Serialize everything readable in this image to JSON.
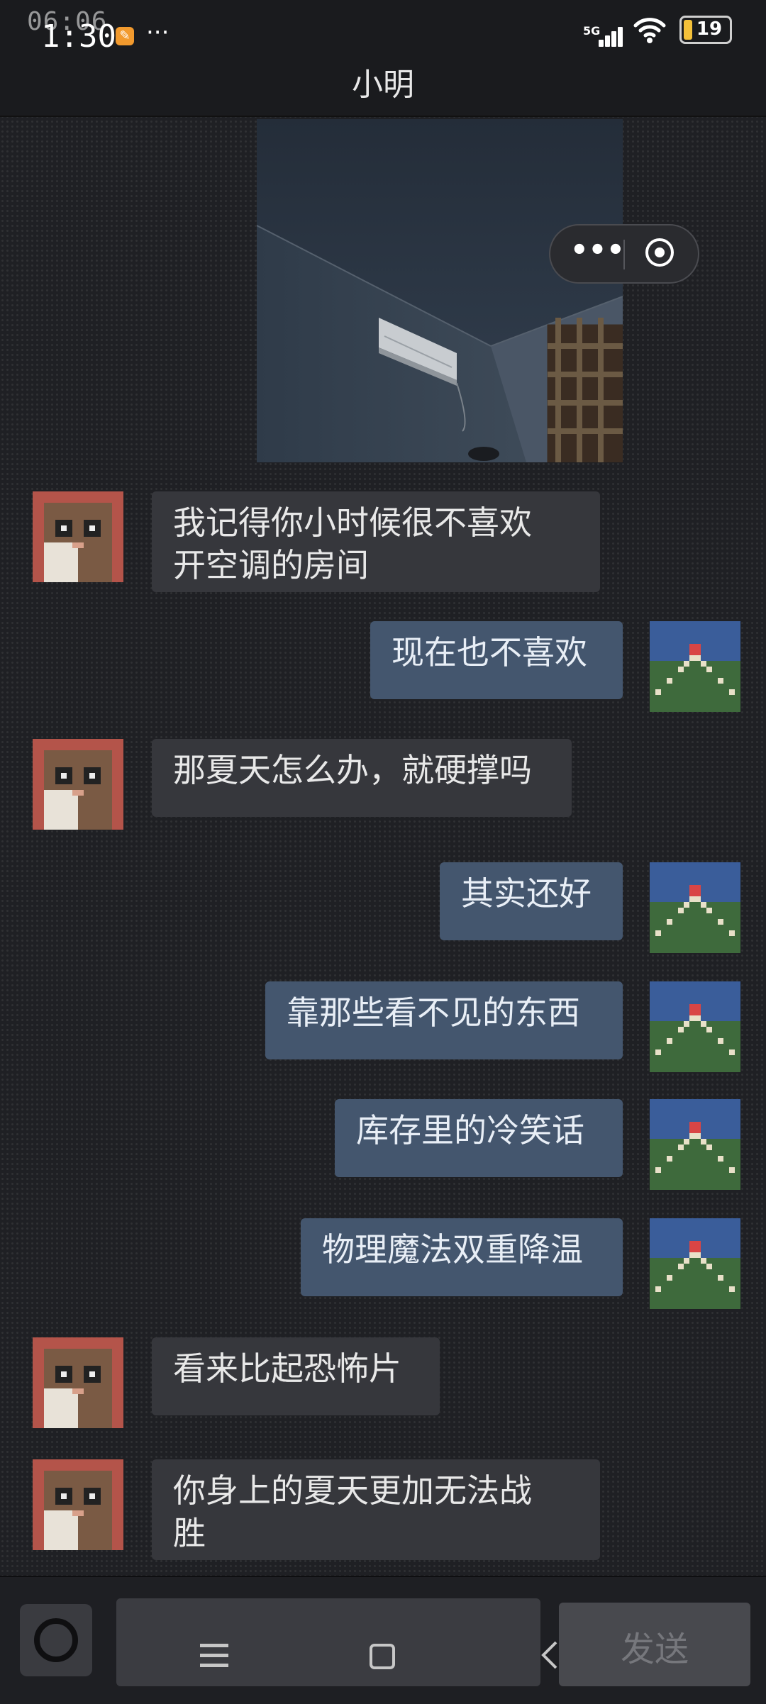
{
  "status_bar": {
    "time": "1:30",
    "time_overlay": "06:06",
    "more": "···",
    "network": "5G",
    "battery": "19"
  },
  "header": {
    "title": "小明"
  },
  "capsule": {
    "more": "•••"
  },
  "messages": [
    {
      "side": "left",
      "text_lines": [
        "我记得你小时候很不喜欢",
        "开空调的房间"
      ]
    },
    {
      "side": "right",
      "text": "现在也不喜欢"
    },
    {
      "side": "left",
      "text": "那夏天怎么办，就硬撑吗"
    },
    {
      "side": "right",
      "text": "其实还好"
    },
    {
      "side": "right",
      "text": "靠那些看不见的东西"
    },
    {
      "side": "right",
      "text": "库存里的冷笑话"
    },
    {
      "side": "right",
      "text": "物理魔法双重降温"
    },
    {
      "side": "left",
      "text": "看来比起恐怖片"
    },
    {
      "side": "left",
      "text_lines": [
        "你身上的夏天更加无法战",
        "胜"
      ]
    }
  ],
  "input_bar": {
    "send_label": "发送"
  },
  "colors": {
    "left_bubble": "#36373c",
    "right_bubble": "#44566e",
    "background": "#1f2024"
  },
  "icons": [
    "notification-icon",
    "signal-icon",
    "wifi-icon",
    "battery-icon",
    "more-icon",
    "target-icon",
    "camera-icon",
    "menu-icon",
    "home-icon",
    "back-icon"
  ]
}
